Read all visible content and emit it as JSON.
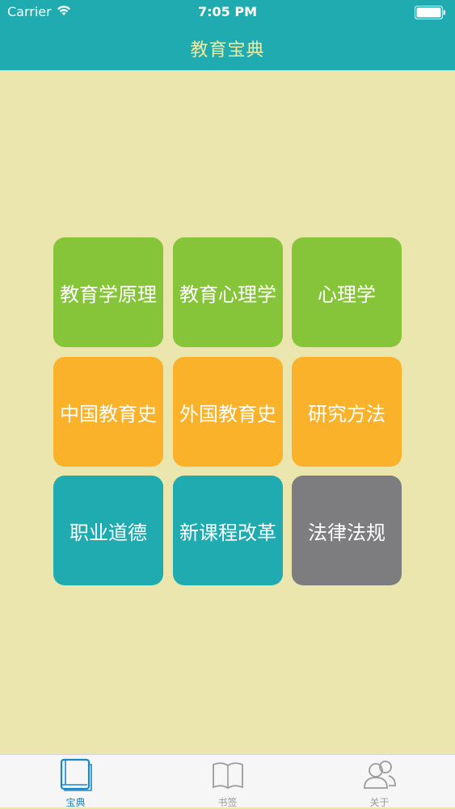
{
  "status_bar": {
    "carrier": "Carrier",
    "time": "7:05 PM"
  },
  "header": {
    "title": "教育宝典"
  },
  "grid": {
    "tiles": [
      {
        "label": "教育学原理",
        "color": "#86c43a"
      },
      {
        "label": "教育心理学",
        "color": "#86c43a"
      },
      {
        "label": "心理学",
        "color": "#86c43a"
      },
      {
        "label": "中国教育史",
        "color": "#f9b22a"
      },
      {
        "label": "外国教育史",
        "color": "#f9b22a"
      },
      {
        "label": "研究方法",
        "color": "#f9b22a"
      },
      {
        "label": "职业道德",
        "color": "#1fabb0"
      },
      {
        "label": "新课程改革",
        "color": "#1fabb0"
      },
      {
        "label": "法律法规",
        "color": "#7d7d7f"
      }
    ]
  },
  "tabbar": {
    "tabs": [
      {
        "label": "宝典",
        "icon": "book-icon",
        "active": true
      },
      {
        "label": "书签",
        "icon": "open-book-icon",
        "active": false
      },
      {
        "label": "关于",
        "icon": "people-icon",
        "active": false
      }
    ],
    "active_color": "#1a87c9",
    "inactive_color": "#9b9b9b"
  },
  "colors": {
    "header": "#1fabb0",
    "background": "#ebe6ae",
    "title_text": "#f2ea9c"
  }
}
